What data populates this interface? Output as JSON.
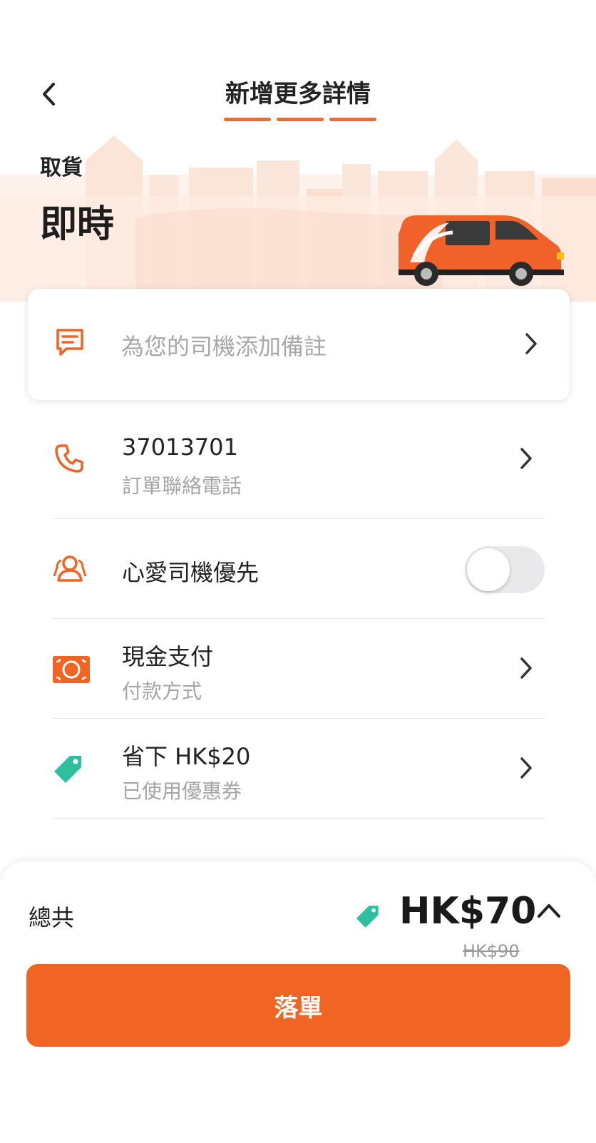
{
  "header": {
    "title": "新增更多詳情",
    "steps_completed": 3
  },
  "pickup": {
    "label": "取貨",
    "value": "即時"
  },
  "note": {
    "placeholder": "為您的司機添加備註"
  },
  "rows": {
    "phone": {
      "main": "37013701",
      "sub": "訂單聯絡電話"
    },
    "favorite_driver": {
      "main": "心愛司機優先",
      "toggle_on": false
    },
    "payment": {
      "main": "現金支付",
      "sub": "付款方式"
    },
    "coupon": {
      "main": "省下 HK$20",
      "sub": "已使用優惠券"
    }
  },
  "total": {
    "label": "總共",
    "price": "HK$70",
    "original_price": "HK$90"
  },
  "submit_label": "落單",
  "colors": {
    "accent": "#f06524",
    "coupon_green": "#2dbf9e",
    "muted_text": "#a8a8a8"
  },
  "icons": [
    "back-chevron-icon",
    "note-icon",
    "phone-icon",
    "driver-icon",
    "cash-icon",
    "coupon-tag-icon",
    "chevron-right-icon",
    "chevron-up-icon"
  ]
}
